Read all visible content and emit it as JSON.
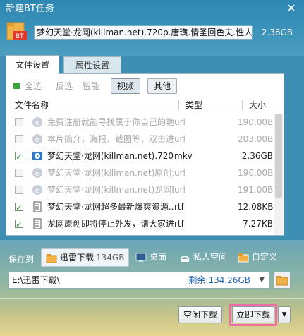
{
  "window": {
    "title": "新建BT任务",
    "close_symbol": "✕"
  },
  "torrent": {
    "name": "梦幻天堂·龙网(killman.net).720p.唐璜.情圣回色夫.性人...",
    "total_size": "2.36GB",
    "icon_label": "BT"
  },
  "tabs": [
    {
      "label": "文件设置",
      "active": true
    },
    {
      "label": "属性设置",
      "active": false
    }
  ],
  "filters": {
    "select_all": "全选",
    "invert": "反选",
    "smart": "智能",
    "video": "视频",
    "other": "其他"
  },
  "columns": {
    "name": "文件名称",
    "type": "类型",
    "size": "大小"
  },
  "files": [
    {
      "checked": false,
      "icon": "ie-icon",
      "name": "免费注册就能寻找属于你自己的艳...",
      "type": "url",
      "size": "190.00B",
      "dim": true
    },
    {
      "checked": false,
      "icon": "ie-icon",
      "name": "本片简介，海报，截图等，双击进...",
      "type": "url",
      "size": "203.00B",
      "dim": true
    },
    {
      "checked": true,
      "icon": "video-icon",
      "name": "梦幻天堂·龙网(killman.net).720p....",
      "type": "mkv",
      "size": "2.36GB",
      "dim": false
    },
    {
      "checked": false,
      "icon": "ie-icon",
      "name": "梦幻天堂·龙网(killman.net)原创大...",
      "type": "url",
      "size": "196.00B",
      "dim": true
    },
    {
      "checked": false,
      "icon": "ie-icon",
      "name": "梦幻天堂·龙网(killman.net)龙网BT...",
      "type": "url",
      "size": "191.00B",
      "dim": true
    },
    {
      "checked": true,
      "icon": "doc-icon",
      "name": "梦幻天堂·龙网超多最新爆爽资源...",
      "type": "rtf",
      "size": "12.08KB",
      "dim": false
    },
    {
      "checked": true,
      "icon": "doc-icon",
      "name": "龙网原创即将停止外发，请大家进...",
      "type": "rtf",
      "size": "7.27KB",
      "dim": false
    }
  ],
  "save": {
    "label": "保存到",
    "options": [
      {
        "label": "迅雷下载",
        "badge": "134GB",
        "selected": true
      },
      {
        "label": "桌面",
        "badge": "",
        "selected": false
      },
      {
        "label": "私人空间",
        "badge": "",
        "selected": false
      },
      {
        "label": "自定义",
        "badge": "",
        "selected": false
      }
    ],
    "path": "E:\\迅雷下载\\",
    "remaining": "剩余:134.26GB"
  },
  "buttons": {
    "idle_download": "空闲下载",
    "download_now": "立即下载",
    "more": "▼"
  },
  "colors": {
    "accent_pink": "#ee6fa4",
    "link_blue": "#1a64b0",
    "check_green": "#2f9a2f"
  }
}
